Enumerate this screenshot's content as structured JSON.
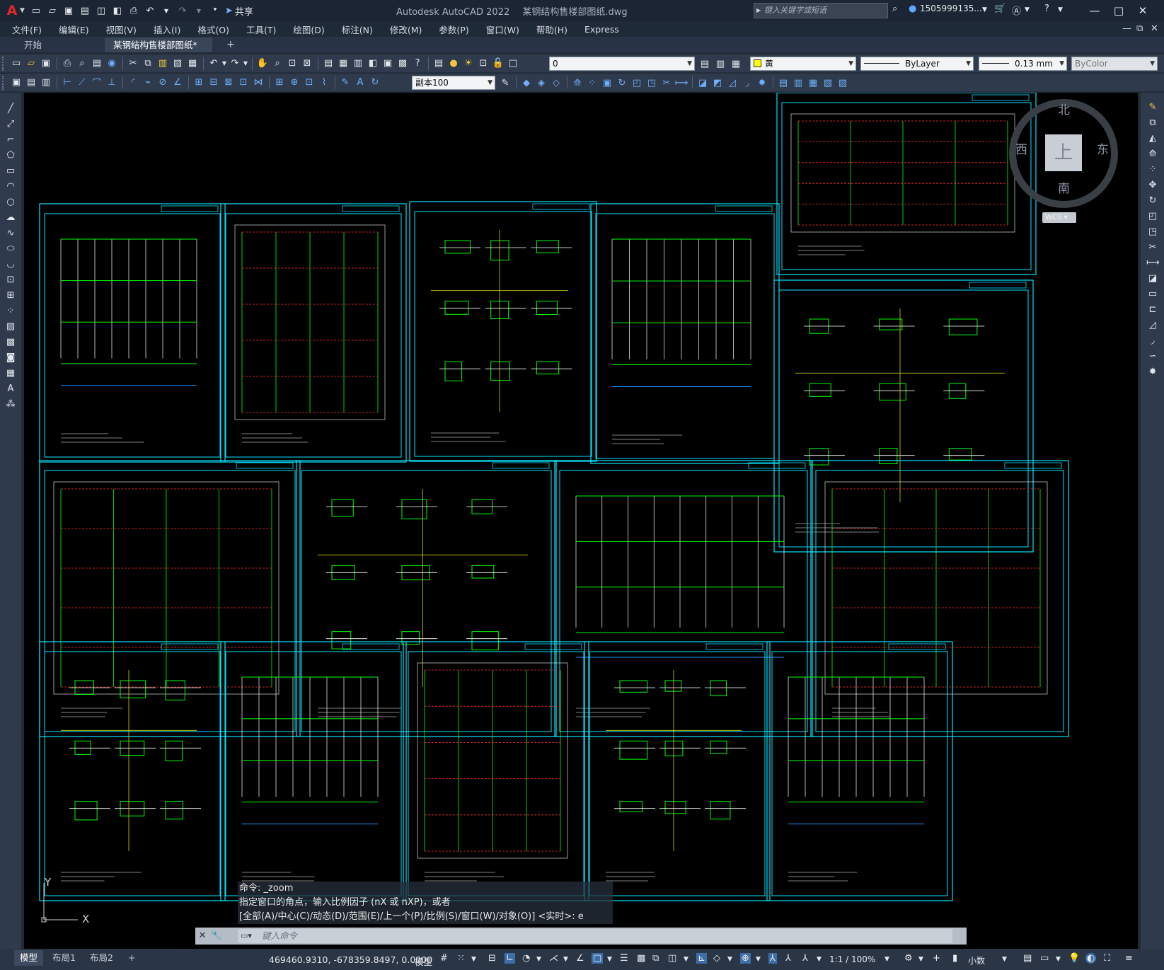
{
  "app": {
    "title": "Autodesk AutoCAD 2022",
    "file": "某钢结构售楼部图纸.dwg",
    "share": "共享",
    "search_placeholder": "键入关键字或短语",
    "user": "1505999135...",
    "logo": "A"
  },
  "menu": [
    "文件(F)",
    "编辑(E)",
    "视图(V)",
    "插入(I)",
    "格式(O)",
    "工具(T)",
    "绘图(D)",
    "标注(N)",
    "修改(M)",
    "参数(P)",
    "窗口(W)",
    "帮助(H)",
    "Express"
  ],
  "tabs": {
    "start": "开始",
    "active": "某钢结构售楼部图纸*",
    "close": "×",
    "plus": "+"
  },
  "toolbar": {
    "layer": "0",
    "color": "黄",
    "color_hex": "#ffff00",
    "linetype": "ByLayer",
    "lineweight": "0.13 mm",
    "plotstyle": "ByColor",
    "dimstyle": "副本100"
  },
  "viewcube": {
    "north": "北",
    "south": "南",
    "east": "东",
    "west": "西",
    "top": "上",
    "wcs": "WCS"
  },
  "ucs": {
    "y": "Y",
    "x": "X"
  },
  "command": {
    "history": [
      "命令: _zoom",
      "指定窗口的角点，输入比例因子 (nX 或 nXP)，或者",
      "[全部(A)/中心(C)/动态(D)/范围(E)/上一个(P)/比例(S)/窗口(W)/对象(O)] <实时>:  e"
    ],
    "placeholder": "键入命令"
  },
  "status": {
    "layout_tabs": [
      "模型",
      "布局1",
      "布局2"
    ],
    "plus": "+",
    "coords": "469460.9310, -678359.8497, 0.0000",
    "model": "模型",
    "scale": "1:1 / 100%",
    "units": "小数"
  },
  "colors": {
    "sheet_frame": "#00e5ff",
    "drawing_green": "#00ff00",
    "drawing_red": "#ff3030",
    "grid_yellow": "#d4d400",
    "canvas": "#000000"
  }
}
